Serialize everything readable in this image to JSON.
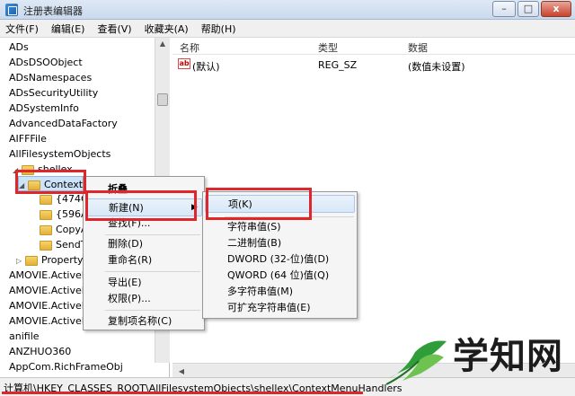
{
  "window": {
    "title": "注册表编辑器",
    "min": "–",
    "max": "□",
    "close": "x"
  },
  "menubar": [
    "文件(F)",
    "编辑(E)",
    "查看(V)",
    "收藏夹(A)",
    "帮助(H)"
  ],
  "tree": {
    "items": [
      {
        "label": "ADs"
      },
      {
        "label": "ADsDSOObject"
      },
      {
        "label": "ADsNamespaces"
      },
      {
        "label": "ADsSecurityUtility"
      },
      {
        "label": "ADSystemInfo"
      },
      {
        "label": "AdvancedDataFactory"
      },
      {
        "label": "AIFFFile"
      },
      {
        "label": "AllFilesystemObjects"
      },
      {
        "label": "shellex"
      },
      {
        "label": "ContextMenuHandlers"
      },
      {
        "label": "{474C9"
      },
      {
        "label": "{596AB"
      },
      {
        "label": "CopyA"
      },
      {
        "label": "SendTo"
      },
      {
        "label": "PropertyS"
      },
      {
        "label": "AMOVIE.ActiveM"
      },
      {
        "label": "AMOVIE.ActiveM"
      },
      {
        "label": "AMOVIE.ActiveM"
      },
      {
        "label": "AMOVIE.ActiveM"
      },
      {
        "label": "anifile"
      },
      {
        "label": "ANZHUO360"
      },
      {
        "label": "AppCom.RichFrameObj"
      }
    ]
  },
  "list": {
    "columns": [
      "名称",
      "类型",
      "数据"
    ],
    "rows": [
      {
        "name": "(默认)",
        "type": "REG_SZ",
        "data": "(数值未设置)",
        "icon": "ab"
      }
    ]
  },
  "context_menu": {
    "items": [
      "折叠",
      "新建(N)",
      "查找(F)...",
      "删除(D)",
      "重命名(R)",
      "导出(E)",
      "权限(P)...",
      "复制项名称(C)"
    ]
  },
  "new_submenu": {
    "items": [
      "项(K)",
      "字符串值(S)",
      "二进制值(B)",
      "DWORD (32-位)值(D)",
      "QWORD (64 位)值(Q)",
      "多字符串值(M)",
      "可扩充字符串值(E)"
    ]
  },
  "status": "计算机\\HKEY_CLASSES_ROOT\\AllFilesystemObjects\\shellex\\ContextMenuHandlers",
  "watermark": "学知网",
  "colors": {
    "accent_red": "#e0262b",
    "watermark_green": "#2f9e3a"
  }
}
